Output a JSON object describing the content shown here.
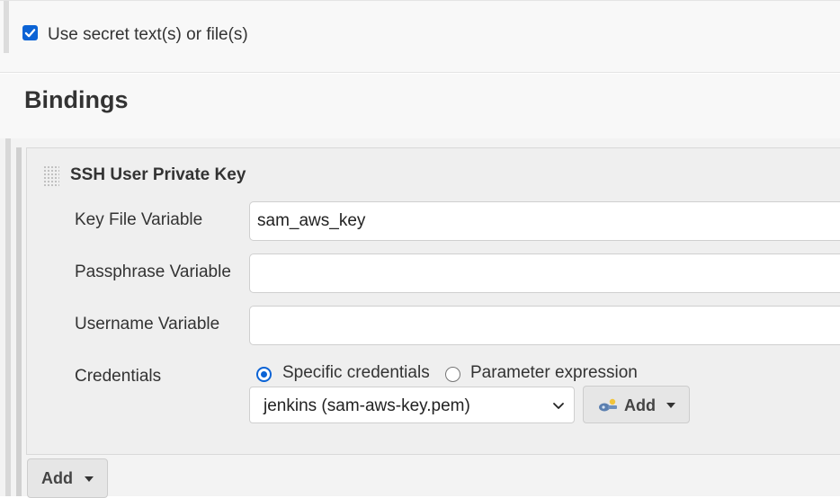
{
  "options": {
    "use_secret_label": "Use secret text(s) or file(s)",
    "use_secret_checked": true
  },
  "section": {
    "title": "Bindings"
  },
  "binding": {
    "title": "SSH User Private Key",
    "fields": {
      "key_file_label": "Key File Variable",
      "key_file_value": "sam_aws_key",
      "passphrase_label": "Passphrase Variable",
      "passphrase_value": "",
      "username_label": "Username Variable",
      "username_value": "",
      "credentials_label": "Credentials"
    },
    "credentials": {
      "radio_specific": "Specific credentials",
      "radio_param": "Parameter expression",
      "selected_mode": "specific",
      "selected_value": "jenkins (sam-aws-key.pem)",
      "add_label": "Add"
    }
  },
  "add_binding_label": "Add",
  "colors": {
    "accent": "#0b63d5",
    "button_bg": "#e6e6e6"
  },
  "icons": {
    "add_credential": "key-icon",
    "dropdown": "chevron-down-icon",
    "drag": "drag-handle-icon"
  }
}
